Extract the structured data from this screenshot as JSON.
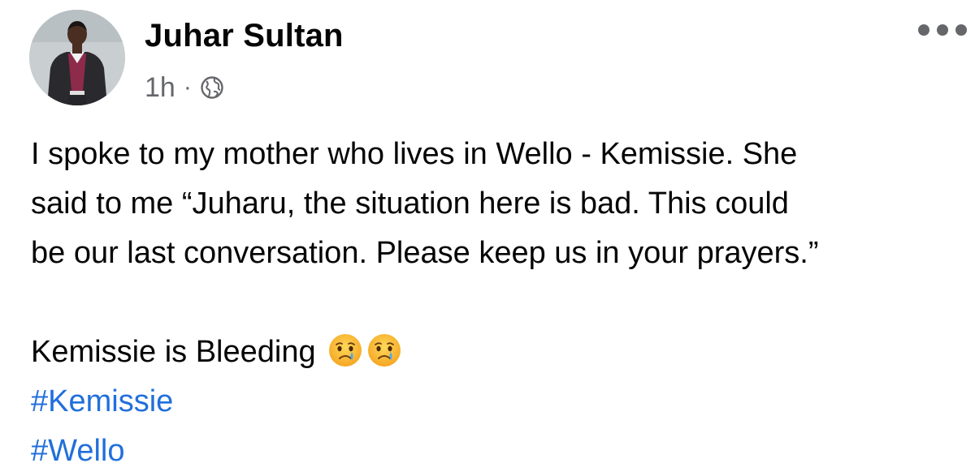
{
  "post": {
    "author": "Juhar Sultan",
    "time": "1h",
    "separator": "·",
    "privacy_icon": "globe-icon",
    "more_icon": "more-options-icon",
    "avatar_icon": "profile-photo",
    "lines": [
      "I spoke to  my mother who lives in Wello - Kemissie. She",
      "said to me “Juharu, the situation here is bad. This could",
      "be our last conversation. Please keep us in your prayers.”"
    ],
    "closing": "Kemissie is Bleeding",
    "emoji_icon": "crying-face-emoji",
    "emoji_count": 2,
    "hashtags": [
      "#Kemissie",
      "#Wello"
    ]
  },
  "colors": {
    "text": "#050505",
    "secondary": "#65676b",
    "link": "#216fdb"
  }
}
